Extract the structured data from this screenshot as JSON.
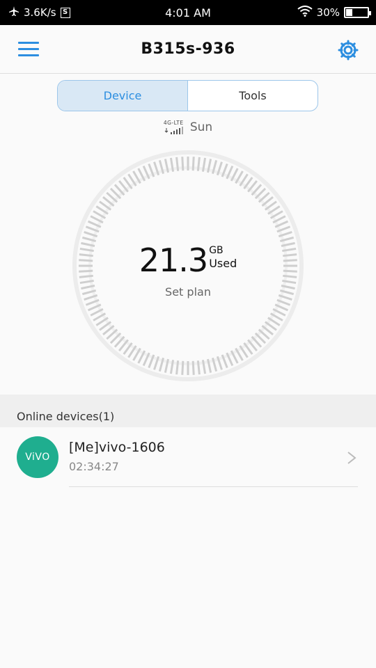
{
  "status_bar": {
    "speed": "3.6K/s",
    "sim_badge": "S",
    "time": "4:01 AM",
    "battery_text": "30%",
    "battery_level": 0.3
  },
  "header": {
    "title": "B315s-936"
  },
  "tabs": [
    {
      "label": "Device",
      "active": true
    },
    {
      "label": "Tools",
      "active": false
    }
  ],
  "network": {
    "type": "4G-LTE",
    "carrier": "Sun"
  },
  "usage": {
    "value": "21.3",
    "unit": "GB",
    "label": "Used",
    "set_plan": "Set plan"
  },
  "online_devices": {
    "header": "Online devices(1)",
    "items": [
      {
        "avatar_text": "ViVO",
        "name": "[Me]vivo-1606",
        "duration": "02:34:27"
      }
    ]
  },
  "colors": {
    "accent": "#2c8ee0",
    "avatar": "#1fae8f"
  }
}
